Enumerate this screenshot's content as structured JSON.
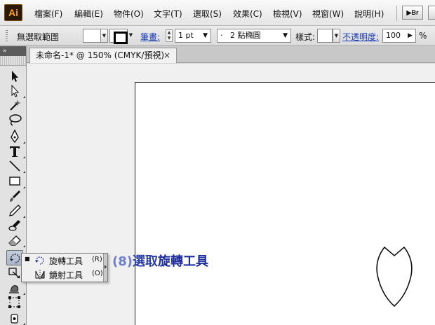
{
  "app": {
    "logo": "Ai"
  },
  "menu": [
    "檔案(F)",
    "編輯(E)",
    "物件(O)",
    "文字(T)",
    "選取(S)",
    "效果(C)",
    "檢視(V)",
    "視窗(W)",
    "說明(H)"
  ],
  "menu_right": {
    "bridge_label": "Br"
  },
  "control": {
    "selection_label": "無選取範圍",
    "stroke_link": "筆畫:",
    "stroke_weight": "1 pt",
    "brush_dot": "·",
    "brush_label": "2 點橢圓",
    "style_label": "樣式:",
    "opacity_link": "不透明度:",
    "opacity_value": "100",
    "opacity_unit": "%"
  },
  "tab": {
    "title": "未命名-1* @ 150% (CMYK/預視)",
    "close": "×"
  },
  "toolbox": {
    "expand": "»"
  },
  "flyout": {
    "items": [
      {
        "label": "旋轉工具",
        "shortcut": "(R)",
        "selected": true
      },
      {
        "label": "鏡射工具",
        "shortcut": "(O)",
        "selected": false
      }
    ],
    "bullet": "■"
  },
  "annotation": {
    "number": "(8)",
    "verb": "選取",
    "target": "旋轉工具"
  },
  "colors": {
    "annotation": "#2d3fa8",
    "link": "#1a3bb3",
    "ai_orange": "#f6a31a"
  }
}
